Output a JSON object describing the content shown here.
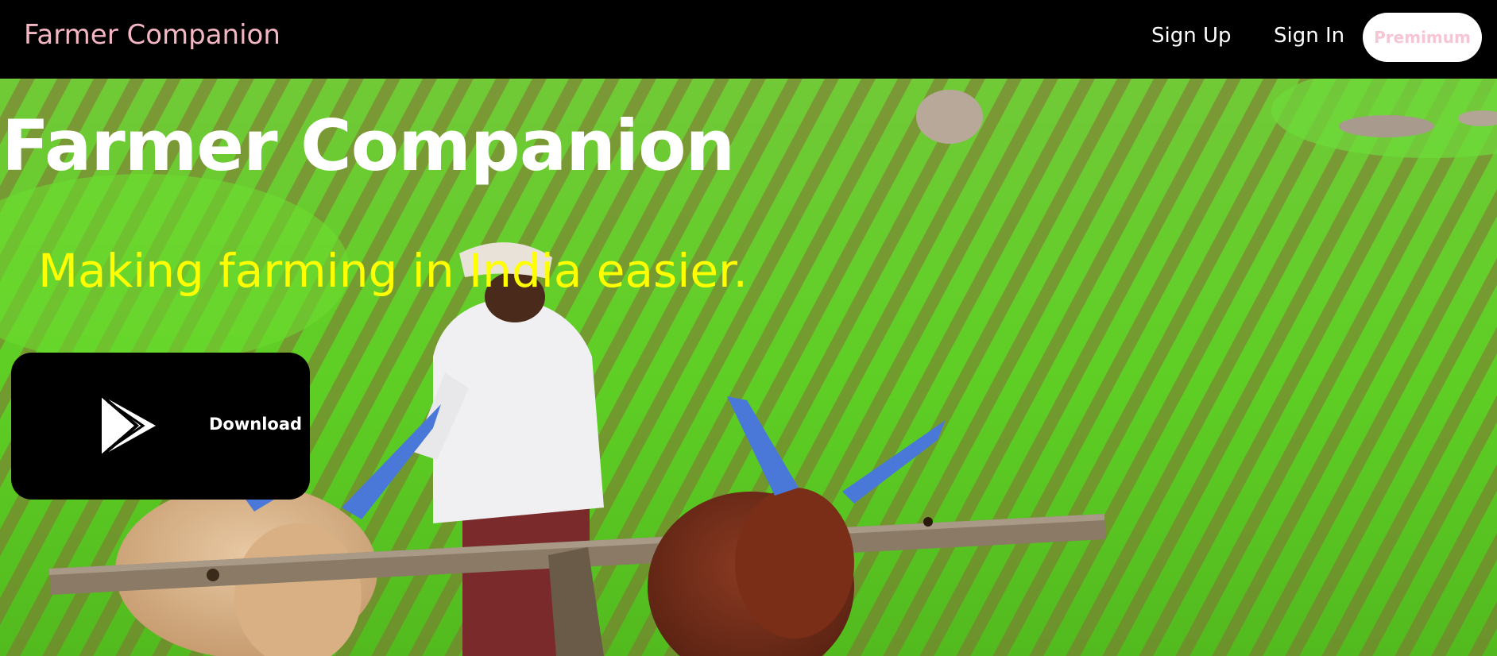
{
  "navbar": {
    "brand": "Farmer Companion",
    "sign_up": "Sign Up",
    "sign_in": "Sign In",
    "premium": "Premimum"
  },
  "hero": {
    "title": "Farmer Companion",
    "tagline": "Making farming in India easier.",
    "download_label": "Download",
    "download_icon": "play-store-icon",
    "background": "farmer-plowing-field-with-oxen-photo"
  },
  "colors": {
    "brand_pink": "#f4b6c2",
    "tagline_yellow": "#ffff00",
    "premium_text": "#f6c6d4",
    "field_green": "#5fcf2a"
  }
}
